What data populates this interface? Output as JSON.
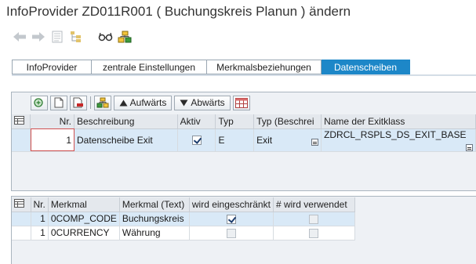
{
  "window": {
    "title": "InfoProvider ZD011R001 ( Buchungskreis Planun ) ändern"
  },
  "app_toolbar": {
    "icons": [
      "back-arrow-icon",
      "forward-arrow-icon",
      "overview-icon",
      "hierarchy-icon",
      "glasses-icon",
      "activate-icon"
    ]
  },
  "tabs": [
    {
      "label": "InfoProvider",
      "active": false
    },
    {
      "label": "zentrale Einstellungen",
      "active": false
    },
    {
      "label": "Merkmalsbeziehungen",
      "active": false
    },
    {
      "label": "Datenscheiben",
      "active": true
    }
  ],
  "grid_toolbar": {
    "up_label": "Aufwärts",
    "down_label": "Abwärts"
  },
  "exit_table": {
    "columns": [
      "Nr.",
      "Beschreibung",
      "Aktiv",
      "Typ",
      "Typ (Beschrei",
      "Name der Exitklass"
    ],
    "rows": [
      {
        "nr": "1",
        "beschreibung": "Datenscheibe Exit",
        "aktiv": true,
        "typ": "E",
        "typ_text": "Exit",
        "exitklasse": "ZDRCL_RSPLS_DS_EXIT_BASE"
      }
    ]
  },
  "merkmal_table": {
    "columns": [
      "Nr.",
      "Merkmal",
      "Merkmal (Text)",
      "wird eingeschränkt",
      "# wird verwendet"
    ],
    "rows": [
      {
        "nr": "1",
        "merkmal": "0COMP_CODE",
        "text": "Buchungskreis",
        "eingeschraenkt": true,
        "verwendet": false
      },
      {
        "nr": "1",
        "merkmal": "0CURRENCY",
        "text": "Währung",
        "eingeschraenkt": false,
        "verwendet": false
      }
    ]
  },
  "colors": {
    "accent": "#1d87c8",
    "selected_row": "#d9e9f7"
  }
}
